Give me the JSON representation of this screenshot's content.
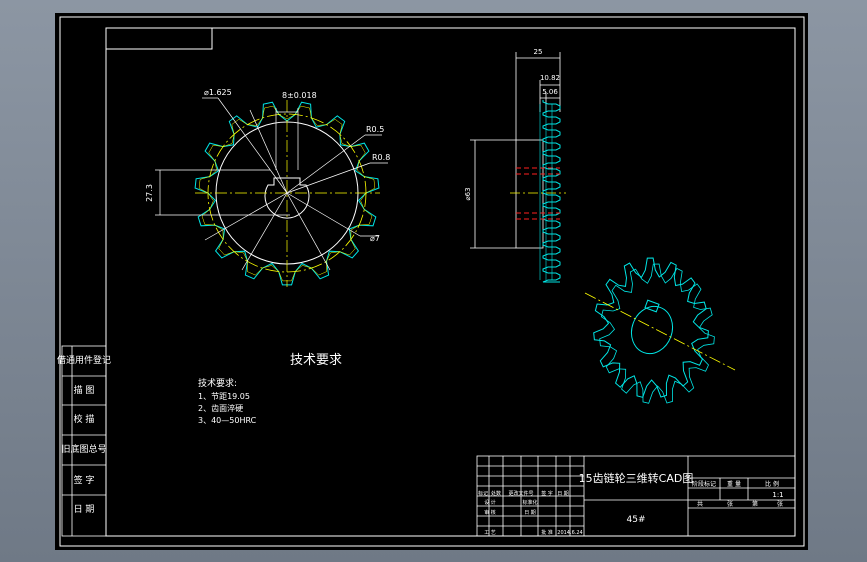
{
  "drawing": {
    "title": "15齿链轮三维转CAD图",
    "material": "45#",
    "scale": "1:1"
  },
  "tech": {
    "heading": "技术要求",
    "subheading": "技术要求:",
    "items": [
      "1、节距19.05",
      "2、齿面淬硬",
      "3、40—50HRC"
    ]
  },
  "dims": {
    "d_top": "⌀1.625",
    "d_key": "8±0.018",
    "r_small": "R0.5",
    "r_large": "R0.8",
    "hub_height": "27.3",
    "bore": "⌀7",
    "width_total": "25",
    "width_mid": "10.82",
    "width_tooth": "5.06",
    "dia_hub": "⌀63"
  },
  "side_table": [
    "借通用件登记",
    "描 图",
    "校 描",
    "旧底图总号",
    "签 字",
    "日 期"
  ],
  "title_block": {
    "right_headers": [
      "阶段标记",
      "重 量",
      "比 例"
    ],
    "sheet_row": [
      "共",
      "张",
      "第",
      "张"
    ],
    "left_headers": [
      "标记",
      "处数",
      "更改文件号",
      "签 字",
      "日 期"
    ],
    "left_rows": [
      "设 计",
      "审 核",
      "工 艺"
    ],
    "left_rows_extra": [
      "标准化",
      "日 期",
      "批 准"
    ],
    "date_value": "2014.6.24"
  },
  "colors": {
    "frame": "#ffffff",
    "part": "#00e5e5",
    "center": "#ffff00",
    "hidden": "#ff2020",
    "paper": "#000000"
  }
}
